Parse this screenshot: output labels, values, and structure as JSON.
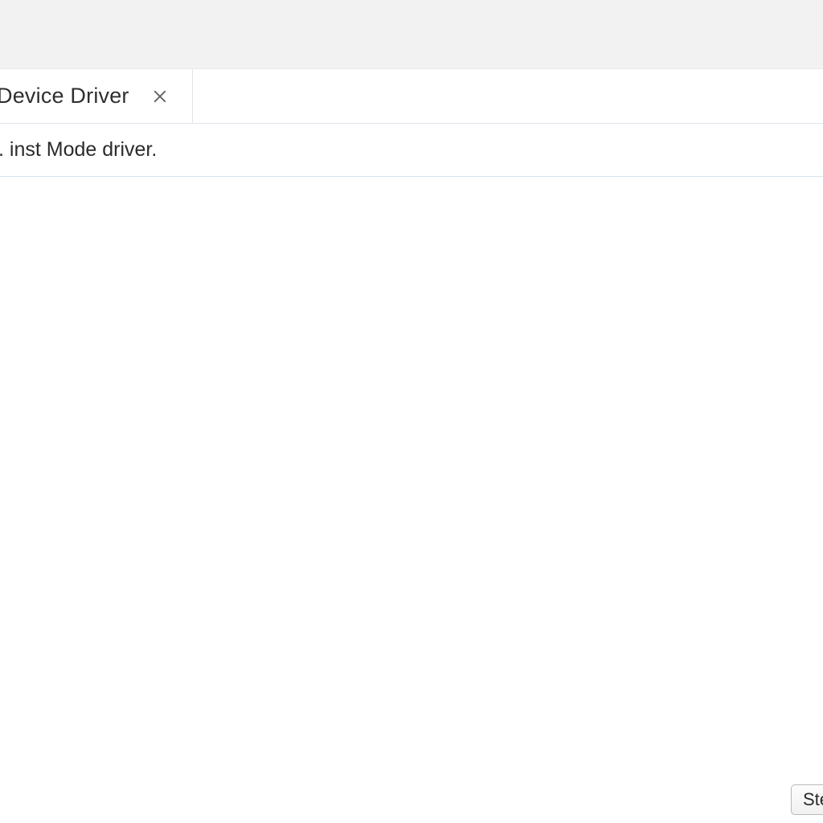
{
  "tab": {
    "label": "Device Driver"
  },
  "info": {
    "text": ". inst Mode driver."
  },
  "footer": {
    "button_label": "Ste"
  }
}
